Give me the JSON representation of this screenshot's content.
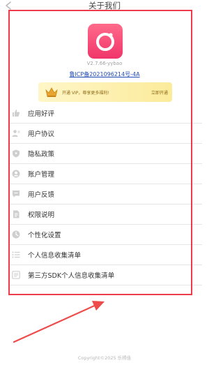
{
  "header": {
    "title": "关于我们"
  },
  "app": {
    "version": "V2.7.66-yybao",
    "icp": "鲁ICP备2021096214号-4A"
  },
  "vip_banner": {
    "text": "开通 VIP，尊享更多福利!",
    "action": "立即开通"
  },
  "menu": {
    "items": [
      {
        "label": "应用好评",
        "icon": "thumbs-up-icon"
      },
      {
        "label": "用户协议",
        "icon": "user-agreement-icon"
      },
      {
        "label": "隐私政策",
        "icon": "shield-icon"
      },
      {
        "label": "账户管理",
        "icon": "account-icon"
      },
      {
        "label": "用户反馈",
        "icon": "feedback-icon"
      },
      {
        "label": "权限说明",
        "icon": "document-icon"
      },
      {
        "label": "个性化设置",
        "icon": "settings-icon"
      },
      {
        "label": "个人信息收集清单",
        "icon": "list-icon"
      },
      {
        "label": "第三方SDK个人信息收集清单",
        "icon": "sdk-list-icon"
      }
    ]
  },
  "footer": {
    "copyright": "Copyright©2025 乐得佳"
  },
  "colors": {
    "highlight": "#ee3b4b",
    "brand": "#f0356a",
    "link": "#1e49b5",
    "vip_text": "#8e6a17",
    "icon": "#cfcfcf"
  }
}
